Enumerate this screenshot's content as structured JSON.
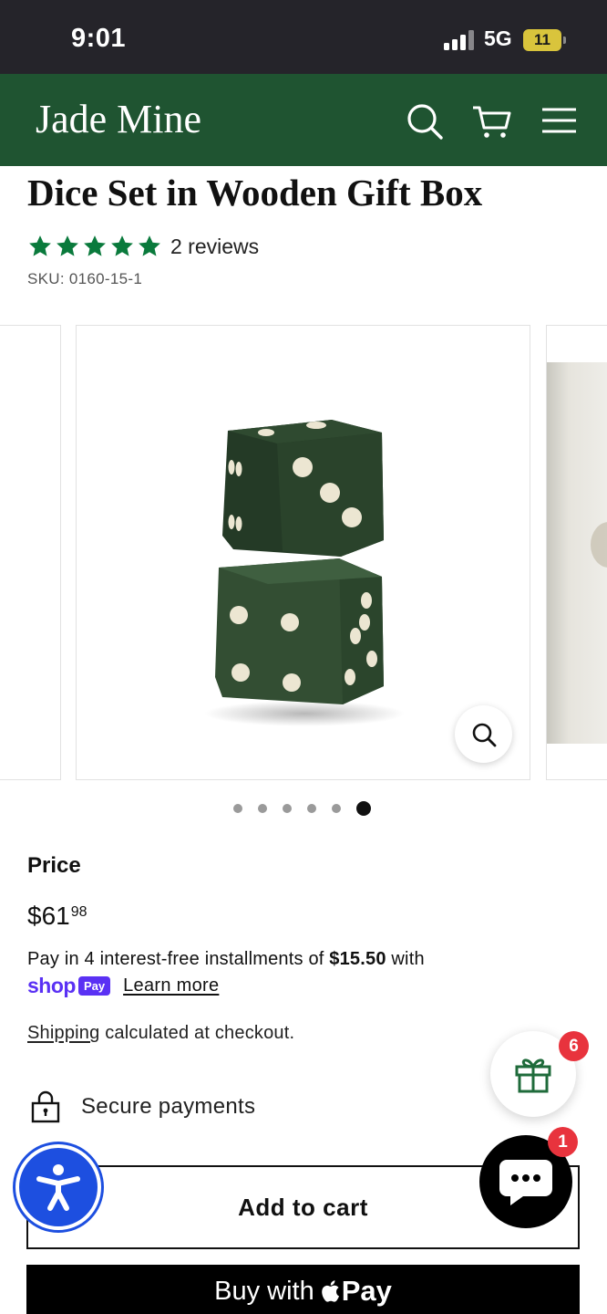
{
  "status_bar": {
    "time": "9:01",
    "network": "5G",
    "battery": "11"
  },
  "header": {
    "logo": "Jade Mine",
    "icons": [
      "search-icon",
      "cart-icon",
      "menu-icon"
    ],
    "background": "#1f5431"
  },
  "product": {
    "title": "Dice Set in Wooden Gift Box",
    "rating": 5,
    "reviews": "2 reviews",
    "sku": "SKU: 0160-15-1",
    "star_color": "#0a7a3c"
  },
  "gallery": {
    "slides": 6,
    "active_slide": 6
  },
  "price": {
    "label": "Price",
    "main": "$61",
    "cents": "98",
    "installments_pre": "Pay in 4 interest-free installments of ",
    "installment_amount": "$15.50",
    "installments_post": " with",
    "shop_word": "shop",
    "pay_badge": "Pay",
    "learn_more": "Learn more",
    "shipping_link": "Shipping",
    "shipping_text": " calculated at checkout."
  },
  "secure": {
    "text": "Secure payments"
  },
  "buttons": {
    "add_to_cart": "Add to cart",
    "buy_with": "Buy with",
    "apple_pay": "Pay"
  },
  "widgets": {
    "gift_badge": "6",
    "chat_badge": "1"
  },
  "colors": {
    "shop_pay": "#5a31f4",
    "badge": "#e8333d",
    "accessibility": "#1d4fe0"
  }
}
